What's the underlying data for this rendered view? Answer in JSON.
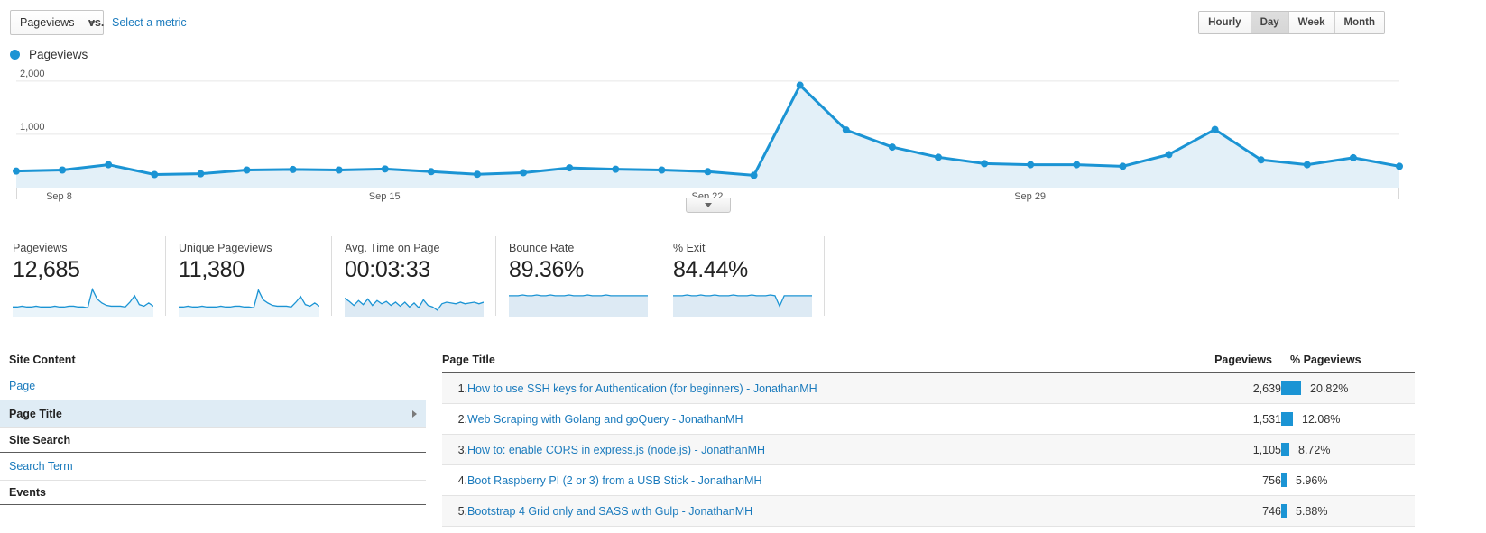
{
  "toolbar": {
    "metric_select_label": "Pageviews",
    "metric_select_icon": "chevron-down-icon",
    "vs_label": "vs.",
    "select_metric_link": "Select a metric",
    "periods": [
      {
        "label": "Hourly",
        "active": false
      },
      {
        "label": "Day",
        "active": true
      },
      {
        "label": "Week",
        "active": false
      },
      {
        "label": "Month",
        "active": false
      }
    ]
  },
  "legend": {
    "series_label": "Pageviews",
    "color": "#1b94d4"
  },
  "chart_data": {
    "type": "line",
    "title": "Pageviews",
    "xlabel": "",
    "ylabel": "",
    "ylim": [
      0,
      2200
    ],
    "grid": true,
    "legend_position": "top-left",
    "ytick_labels": [
      "1,000",
      "2,000"
    ],
    "yticks": [
      1000,
      2000
    ],
    "xtick_labels": [
      "Sep 8",
      "Sep 15",
      "Sep 22",
      "Sep 29"
    ],
    "xtick_indices": [
      1,
      8,
      15,
      22
    ],
    "series": [
      {
        "name": "Pageviews",
        "color": "#1b94d4",
        "fill": "#e3f0f8",
        "values": [
          310,
          330,
          430,
          245,
          260,
          330,
          340,
          330,
          350,
          300,
          250,
          280,
          370,
          345,
          330,
          300,
          230,
          1920,
          1080,
          760,
          570,
          450,
          430,
          430,
          400,
          620,
          1090,
          520,
          430,
          560,
          400
        ]
      }
    ]
  },
  "cards": [
    {
      "title": "Pageviews",
      "value": "12,685",
      "spark": [
        12,
        12,
        13,
        12,
        12,
        13,
        12,
        12,
        12,
        13,
        12,
        12,
        13,
        13,
        12,
        12,
        11,
        34,
        22,
        17,
        14,
        13,
        13,
        13,
        12,
        18,
        26,
        15,
        13,
        17,
        13
      ],
      "spark_filled": false
    },
    {
      "title": "Unique Pageviews",
      "value": "11,380",
      "spark": [
        12,
        12,
        13,
        12,
        12,
        13,
        12,
        12,
        12,
        13,
        12,
        12,
        13,
        13,
        12,
        12,
        11,
        33,
        21,
        17,
        14,
        13,
        13,
        13,
        12,
        18,
        25,
        15,
        13,
        17,
        13
      ],
      "spark_filled": false
    },
    {
      "title": "Avg. Time on Page",
      "value": "00:03:33",
      "spark": [
        23,
        19,
        14,
        20,
        15,
        22,
        14,
        20,
        16,
        19,
        14,
        18,
        13,
        18,
        12,
        17,
        11,
        21,
        14,
        12,
        8,
        16,
        18,
        17,
        16,
        18,
        16,
        17,
        18,
        16,
        18
      ],
      "spark_filled": true
    },
    {
      "title": "Bounce Rate",
      "value": "89.36%",
      "spark": [
        26,
        26,
        26,
        27,
        26,
        26,
        27,
        26,
        26,
        27,
        26,
        26,
        26,
        27,
        26,
        26,
        26,
        27,
        26,
        26,
        26,
        27,
        26,
        26,
        26,
        26,
        26,
        26,
        26,
        26,
        26
      ],
      "spark_filled": true
    },
    {
      "title": "% Exit",
      "value": "84.44%",
      "spark": [
        26,
        26,
        26,
        27,
        26,
        26,
        27,
        26,
        26,
        27,
        26,
        26,
        26,
        27,
        26,
        26,
        26,
        27,
        26,
        26,
        26,
        27,
        26,
        13,
        26,
        26,
        26,
        26,
        26,
        26,
        26
      ],
      "spark_filled": true
    }
  ],
  "sidebar": {
    "groups": [
      {
        "title": "Site Content",
        "items": [
          {
            "label": "Page",
            "selected": false
          },
          {
            "label": "Page Title",
            "selected": true,
            "arrow_icon": "chevron-right-icon"
          }
        ]
      },
      {
        "title": "Site Search",
        "items": [
          {
            "label": "Search Term",
            "selected": false
          }
        ]
      },
      {
        "title": "Events",
        "items": []
      }
    ]
  },
  "table": {
    "columns": {
      "title": "Page Title",
      "pageviews": "Pageviews",
      "pct_pageviews": "% Pageviews"
    },
    "rows": [
      {
        "index": "1.",
        "title": "How to use SSH keys for Authentication (for beginners) - JonathanMH",
        "pageviews": "2,639",
        "pct": "20.82%",
        "pct_value": 20.82
      },
      {
        "index": "2.",
        "title": "Web Scraping with Golang and goQuery - JonathanMH",
        "pageviews": "1,531",
        "pct": "12.08%",
        "pct_value": 12.08
      },
      {
        "index": "3.",
        "title": "How to: enable CORS in express.js (node.js) - JonathanMH",
        "pageviews": "1,105",
        "pct": "8.72%",
        "pct_value": 8.72
      },
      {
        "index": "4.",
        "title": "Boot Raspberry PI (2 or 3) from a USB Stick - JonathanMH",
        "pageviews": "756",
        "pct": "5.96%",
        "pct_value": 5.96
      },
      {
        "index": "5.",
        "title": "Bootstrap 4 Grid only and SASS with Gulp - JonathanMH",
        "pageviews": "746",
        "pct": "5.88%",
        "pct_value": 5.88
      }
    ]
  }
}
